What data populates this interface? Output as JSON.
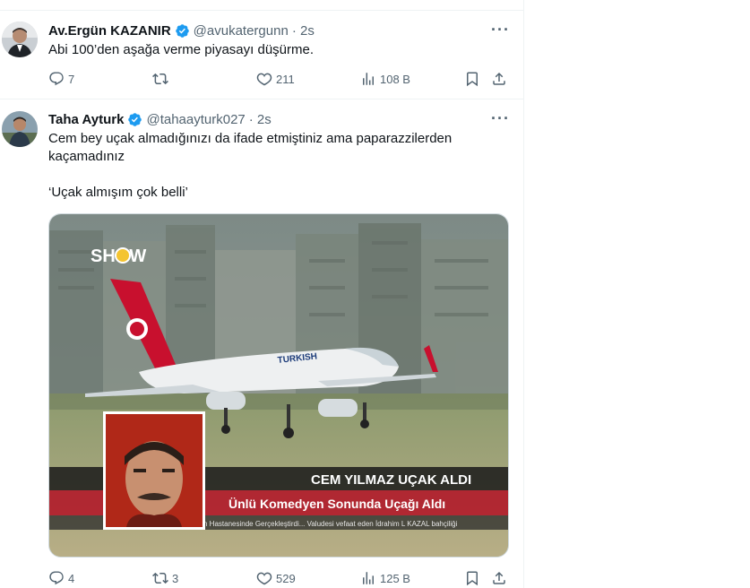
{
  "tweets": [
    {
      "name": "Av.Ergün KAZANIR",
      "handle": "@avukatergunn",
      "time": "· 2s",
      "text": "Abi 100’den aşağa verme piyasayı düşürme.",
      "actions": {
        "reply": "7",
        "retweet": "",
        "like": "211",
        "views": "108 B"
      }
    },
    {
      "name": "Taha Ayturk",
      "handle": "@tahaayturk027",
      "time": "· 2s",
      "text_line1": "Cem bey uçak almadığınızı da ifade etmiştiniz ama paparazzilerden",
      "text_line2": "kaçamadınız",
      "quote": "‘Uçak almışım çok belli’",
      "media": {
        "channel_logo": "SHOW",
        "headline": "CEM YILMAZ UÇAK ALDI",
        "subheadline": "Ünlü Komedyen Sonunda Uçağı Aldı",
        "ticker": "n Hastanesinde Gerçekleştirdi... Valudesi vefaat eden İdrahim L KAZAL bahçiliği",
        "plane_livery": "TURKISH"
      },
      "actions": {
        "reply": "4",
        "retweet": "3",
        "like": "529",
        "views": "125 B"
      }
    }
  ],
  "colors": {
    "accent": "#1d9bf0",
    "muted": "#536471",
    "text": "#0f1419",
    "divider": "#eff3f4"
  },
  "icons": [
    "verified-badge-icon",
    "more-icon",
    "reply-icon",
    "retweet-icon",
    "like-icon",
    "views-icon",
    "bookmark-icon",
    "share-icon"
  ]
}
